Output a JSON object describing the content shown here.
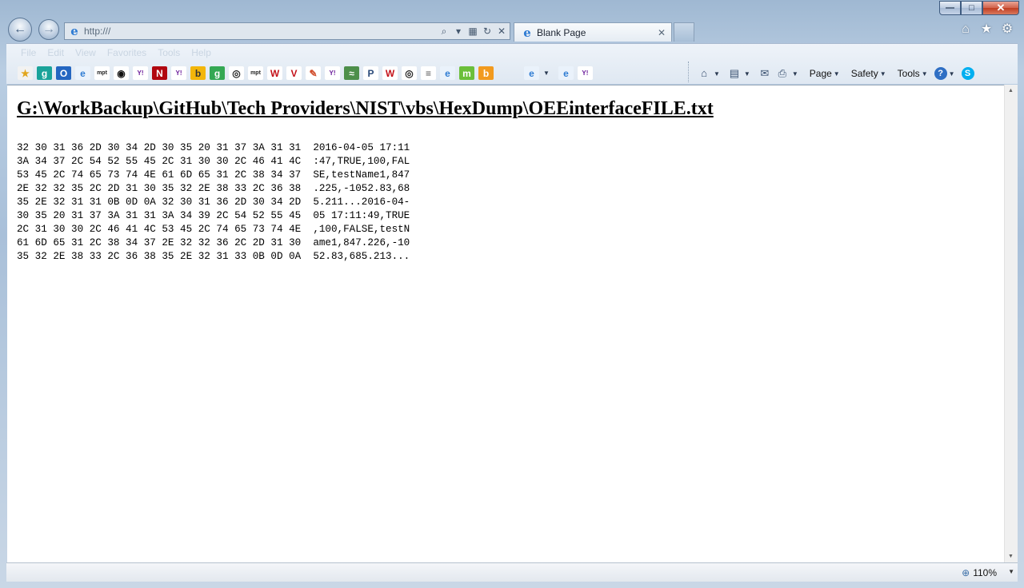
{
  "window": {
    "caption_buttons": {
      "minimize": "—",
      "maximize": "□",
      "close": "✕"
    }
  },
  "nav": {
    "back": "←",
    "forward": "→",
    "address": {
      "value": "http:///",
      "search": "⌕",
      "dropdown": "▾",
      "compat": "▦",
      "refresh": "↻",
      "stop": "✕"
    },
    "tab": {
      "label": "Blank Page",
      "close": "✕"
    },
    "right_icons": {
      "home": "⌂",
      "favorites": "★",
      "tools": "⚙"
    }
  },
  "menu": {
    "items": [
      "File",
      "Edit",
      "View",
      "Favorites",
      "Tools",
      "Help"
    ]
  },
  "favorites_bar": {
    "items": [
      {
        "icon": "favorites-star-icon",
        "text": "★",
        "bg": "#f2f2f2",
        "fg": "#e1a51b"
      },
      {
        "icon": "goodreads-icon",
        "text": "g",
        "bg": "#1aa39a",
        "fg": "#ffffff"
      },
      {
        "icon": "outlook-icon",
        "text": "O",
        "bg": "#2466c1",
        "fg": "#ffffff"
      },
      {
        "icon": "ie-page-icon",
        "text": "e",
        "bg": "#eaf2fb",
        "fg": "#2f7cd3"
      },
      {
        "icon": "mpt-icon",
        "text": "mpt",
        "bg": "#ffffff",
        "fg": "#222222"
      },
      {
        "icon": "pbs-icon",
        "text": "◉",
        "bg": "#ffffff",
        "fg": "#111111"
      },
      {
        "icon": "yahoo-icon",
        "text": "Y!",
        "bg": "#ffffff",
        "fg": "#6a1b9a"
      },
      {
        "icon": "netflix-icon",
        "text": "N",
        "bg": "#b1060f",
        "fg": "#ffffff"
      },
      {
        "icon": "yahoo-icon",
        "text": "Y!",
        "bg": "#ffffff",
        "fg": "#6a1b9a"
      },
      {
        "icon": "bing-icon",
        "text": "b",
        "bg": "#f3b60a",
        "fg": "#333333"
      },
      {
        "icon": "google-icon",
        "text": "g",
        "bg": "#34a853",
        "fg": "#ffffff"
      },
      {
        "icon": "wtop-icon",
        "text": "◎",
        "bg": "#ffffff",
        "fg": "#222222"
      },
      {
        "icon": "mpt-icon",
        "text": "mpt",
        "bg": "#ffffff",
        "fg": "#222222"
      },
      {
        "icon": "washingtonian-icon",
        "text": "W",
        "bg": "#ffffff",
        "fg": "#c4121a"
      },
      {
        "icon": "verizon-icon",
        "text": "V",
        "bg": "#ffffff",
        "fg": "#c4121a"
      },
      {
        "icon": "pencil-icon",
        "text": "✎",
        "bg": "#ffffff",
        "fg": "#d04b2a"
      },
      {
        "icon": "yahoo-icon",
        "text": "Y!",
        "bg": "#ffffff",
        "fg": "#6a1b9a"
      },
      {
        "icon": "landscape-icon",
        "text": "≈",
        "bg": "#4d8f4a",
        "fg": "#ffffff"
      },
      {
        "icon": "parking-icon",
        "text": "P",
        "bg": "#ffffff",
        "fg": "#2a4a7a"
      },
      {
        "icon": "washingtonian-icon",
        "text": "W",
        "bg": "#ffffff",
        "fg": "#c4121a"
      },
      {
        "icon": "wtop-icon",
        "text": "◎",
        "bg": "#ffffff",
        "fg": "#222222"
      },
      {
        "icon": "stack-icon",
        "text": "≡",
        "bg": "#ffffff",
        "fg": "#555555"
      },
      {
        "icon": "ie-page-icon",
        "text": "e",
        "bg": "#eaf2fb",
        "fg": "#2f7cd3"
      },
      {
        "icon": "mm-icon",
        "text": "m",
        "bg": "#6bbf3a",
        "fg": "#ffffff"
      },
      {
        "icon": "bing-b-icon",
        "text": "b",
        "bg": "#f29a1e",
        "fg": "#ffffff"
      }
    ],
    "extra": [
      {
        "icon": "ie-page-icon",
        "text": "e",
        "bg": "#eaf2fb",
        "fg": "#2f7cd3"
      },
      {
        "icon": "ie-page-icon",
        "text": "e",
        "bg": "#eaf2fb",
        "fg": "#2f7cd3"
      },
      {
        "icon": "yahoo-icon",
        "text": "Y!",
        "bg": "#ffffff",
        "fg": "#6a1b9a"
      }
    ]
  },
  "command_bar": {
    "home": "⌂",
    "feeds": "▤",
    "mail": "✉",
    "print": "⎙",
    "page": "Page",
    "safety": "Safety",
    "tools": "Tools",
    "help": "?",
    "skype": "S",
    "arrow": "▼"
  },
  "content": {
    "heading": "G:\\WorkBackup\\GitHub\\Tech Providers\\NIST\\vbs\\HexDump\\OEEinterfaceFILE.txt",
    "hex_dump": "32 30 31 36 2D 30 34 2D 30 35 20 31 37 3A 31 31  2016-04-05 17:11\n3A 34 37 2C 54 52 55 45 2C 31 30 30 2C 46 41 4C  :47,TRUE,100,FAL\n53 45 2C 74 65 73 74 4E 61 6D 65 31 2C 38 34 37  SE,testName1,847\n2E 32 32 35 2C 2D 31 30 35 32 2E 38 33 2C 36 38  .225,-1052.83,68\n35 2E 32 31 31 0B 0D 0A 32 30 31 36 2D 30 34 2D  5.211...2016-04-\n30 35 20 31 37 3A 31 31 3A 34 39 2C 54 52 55 45  05 17:11:49,TRUE\n2C 31 30 30 2C 46 41 4C 53 45 2C 74 65 73 74 4E  ,100,FALSE,testN\n61 6D 65 31 2C 38 34 37 2E 32 32 36 2C 2D 31 30  ame1,847.226,-10\n35 32 2E 38 33 2C 36 38 35 2E 32 31 33 0B 0D 0A  52.83,685.213..."
  },
  "status": {
    "zoom": "110%",
    "zoom_arrow": "▼"
  }
}
